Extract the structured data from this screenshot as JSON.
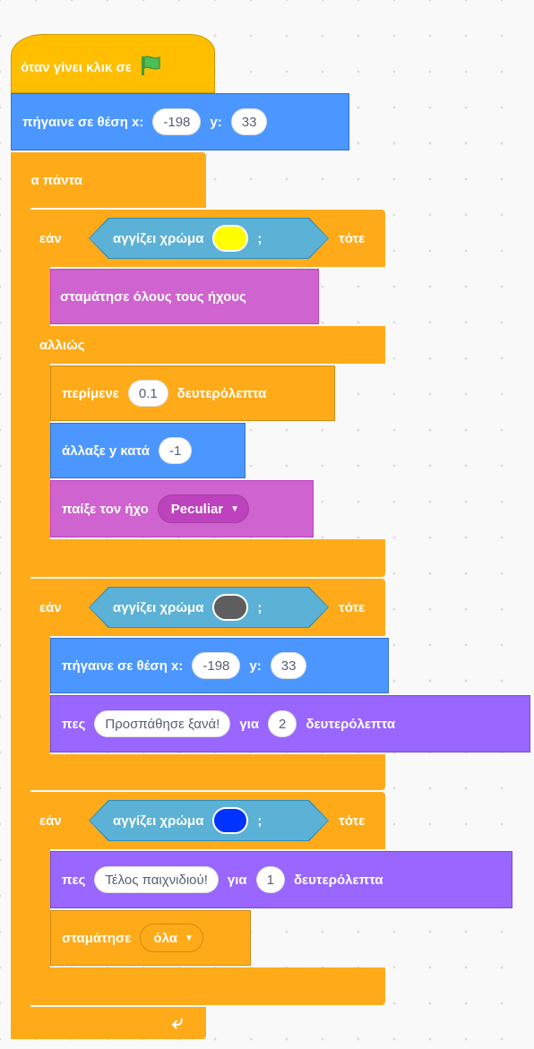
{
  "hat": {
    "label": "όταν γίνει κλικ σε",
    "icon": "green-flag-icon"
  },
  "goto_start": {
    "label_a": "πήγαινε σε θέση x:",
    "x": "-198",
    "label_b": "y:",
    "y": "33"
  },
  "forever": {
    "label": "για πάντα",
    "loop_icon": "loop-arrow-icon"
  },
  "if_else_yellow": {
    "if_label": "εάν",
    "condition_label": "αγγίζει χρώμα",
    "color": "#ffff00",
    "q": ";",
    "then_label": "τότε",
    "if_body": {
      "label": "σταμάτησε όλους τους ήχους"
    },
    "else_label": "αλλιώς",
    "else_body": {
      "wait": {
        "label_a": "περίμενε",
        "value": "0.1",
        "label_b": "δευτερόλεπτα"
      },
      "change_y": {
        "label": "άλλαξε y κατά",
        "value": "-1"
      },
      "play_sound": {
        "label": "παίξε τον ήχο",
        "sound": "Peculiar"
      }
    }
  },
  "if_gray": {
    "if_label": "εάν",
    "condition_label": "αγγίζει χρώμα",
    "color": "#5e5e5e",
    "q": ";",
    "then_label": "τότε",
    "goto": {
      "label_a": "πήγαινε σε θέση x:",
      "x": "-198",
      "label_b": "y:",
      "y": "33"
    },
    "say": {
      "label_a": "πες",
      "message": "Προσπάθησε ξανά!",
      "label_b": "για",
      "secs": "2",
      "label_c": "δευτερόλεπτα"
    }
  },
  "if_blue": {
    "if_label": "εάν",
    "condition_label": "αγγίζει χρώμα",
    "color": "#0033ff",
    "q": ";",
    "then_label": "τότε",
    "say": {
      "label_a": "πες",
      "message": "Τέλος παιχνιδιού!",
      "label_b": "για",
      "secs": "1",
      "label_c": "δευτερόλεπτα"
    },
    "stop": {
      "label": "σταμάτησε",
      "option": "όλα"
    }
  },
  "colors": {
    "events": "#ffbf00",
    "control": "#ffab19",
    "motion": "#4c97ff",
    "sound": "#cf63cf",
    "looks": "#9966ff",
    "sensing": "#5cb1d6"
  }
}
